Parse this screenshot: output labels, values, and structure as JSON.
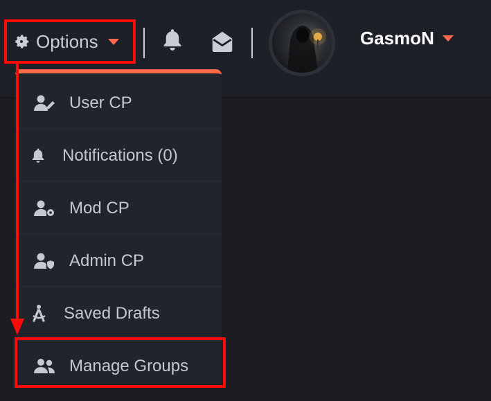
{
  "header": {
    "options_label": "Options",
    "username": "GasmoN"
  },
  "icons": {
    "options": "gear-icon",
    "notifications": "bell-icon",
    "messages": "envelope-open-icon"
  },
  "dropdown": {
    "items": [
      {
        "label": "User CP",
        "icon": "user-edit-icon"
      },
      {
        "label": "Notifications (0)",
        "icon": "bell-icon"
      },
      {
        "label": "Mod CP",
        "icon": "user-gear-icon"
      },
      {
        "label": "Admin CP",
        "icon": "user-shield-icon"
      },
      {
        "label": "Saved Drafts",
        "icon": "compass-drafting-icon"
      },
      {
        "label": "Manage Groups",
        "icon": "user-group-icon"
      }
    ]
  },
  "colors": {
    "accent": "#ff6a4d",
    "highlight": "#ff0a0a",
    "background": "#1b1d23",
    "text": "#c3c8d2",
    "username": "#ffffff"
  }
}
